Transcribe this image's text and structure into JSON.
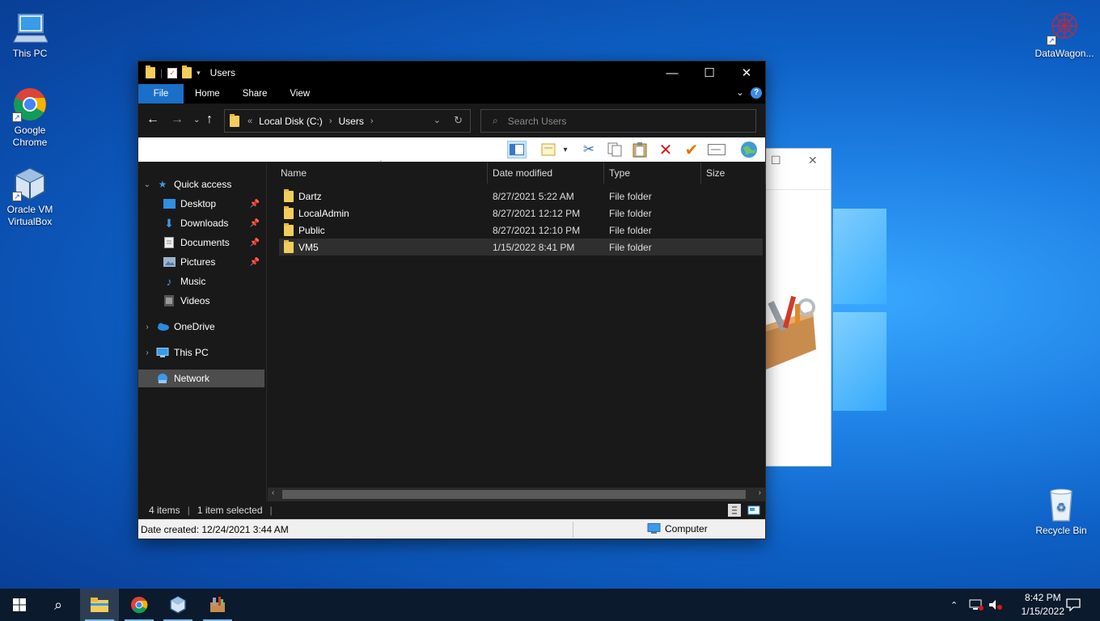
{
  "desktop": {
    "icons": [
      {
        "label": "This PC"
      },
      {
        "label": "Google Chrome"
      },
      {
        "label": "Oracle VM VirtualBox"
      },
      {
        "label": "DataWagon..."
      },
      {
        "label": "Recycle Bin"
      }
    ]
  },
  "explorer": {
    "title": "Users",
    "ribbon_tabs": [
      "File",
      "Home",
      "Share",
      "View"
    ],
    "address": {
      "overflow": "«",
      "crumbs": [
        "Local Disk (C:)",
        "Users"
      ]
    },
    "search": {
      "placeholder": "Search Users"
    },
    "window_controls": {
      "minimize": "—",
      "maximize": "☐",
      "close": "✕"
    },
    "nav": {
      "quick_access": "Quick access",
      "items": [
        "Desktop",
        "Downloads",
        "Documents",
        "Pictures",
        "Music",
        "Videos"
      ],
      "onedrive": "OneDrive",
      "this_pc": "This PC",
      "network": "Network"
    },
    "columns": [
      "Name",
      "Date modified",
      "Type",
      "Size"
    ],
    "files": [
      {
        "name": "Dartz",
        "date": "8/27/2021 5:22 AM",
        "type": "File folder"
      },
      {
        "name": "LocalAdmin",
        "date": "8/27/2021 12:12 PM",
        "type": "File folder"
      },
      {
        "name": "Public",
        "date": "8/27/2021 12:10 PM",
        "type": "File folder"
      },
      {
        "name": "VM5",
        "date": "1/15/2022 8:41 PM",
        "type": "File folder"
      }
    ],
    "status": {
      "count": "4 items",
      "selected": "1 item selected",
      "sep": "|"
    },
    "details": {
      "created": "Date created: 12/24/2021 3:44 AM",
      "location": "Computer"
    }
  },
  "taskbar": {
    "time": "8:42 PM",
    "date": "1/15/2022"
  },
  "colors": {
    "accent": "#1a6fc9",
    "folder": "#f3cd5c",
    "delete": "#d11a1a",
    "check": "#e07a00"
  }
}
